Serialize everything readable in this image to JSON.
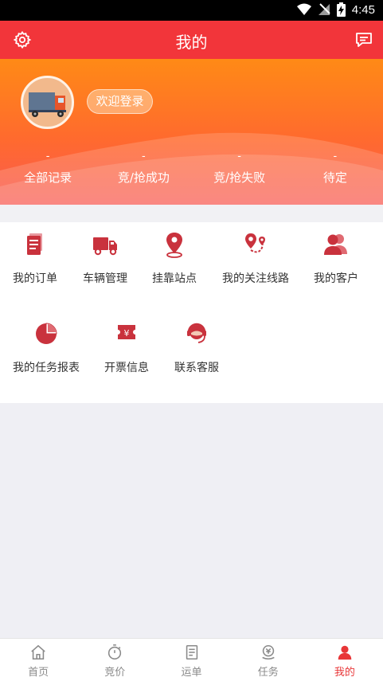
{
  "status_bar": {
    "time": "4:45"
  },
  "header": {
    "title": "我的"
  },
  "profile": {
    "login_label": "欢迎登录"
  },
  "stats": [
    {
      "value": "-",
      "label": "全部记录"
    },
    {
      "value": "-",
      "label": "竞/抢成功"
    },
    {
      "value": "-",
      "label": "竞/抢失败"
    },
    {
      "value": "-",
      "label": "待定"
    }
  ],
  "menu": [
    {
      "label": "我的订单",
      "icon": "order-icon"
    },
    {
      "label": "车辆管理",
      "icon": "truck-icon"
    },
    {
      "label": "挂靠站点",
      "icon": "location-pin-icon"
    },
    {
      "label": "我的关注线路",
      "icon": "route-icon"
    },
    {
      "label": "我的客户",
      "icon": "customers-icon"
    },
    {
      "label": "我的任务报表",
      "icon": "pie-chart-icon"
    },
    {
      "label": "开票信息",
      "icon": "invoice-icon"
    },
    {
      "label": "联系客服",
      "icon": "customer-service-icon"
    }
  ],
  "tabs": [
    {
      "label": "首页",
      "icon": "home-icon"
    },
    {
      "label": "竞价",
      "icon": "stopwatch-icon"
    },
    {
      "label": "运单",
      "icon": "waybill-icon"
    },
    {
      "label": "任务",
      "icon": "task-icon"
    },
    {
      "label": "我的",
      "icon": "user-icon",
      "active": true
    }
  ],
  "colors": {
    "accent": "#f2353a",
    "icon_red": "#c9323d",
    "tab_active": "#e83638"
  }
}
